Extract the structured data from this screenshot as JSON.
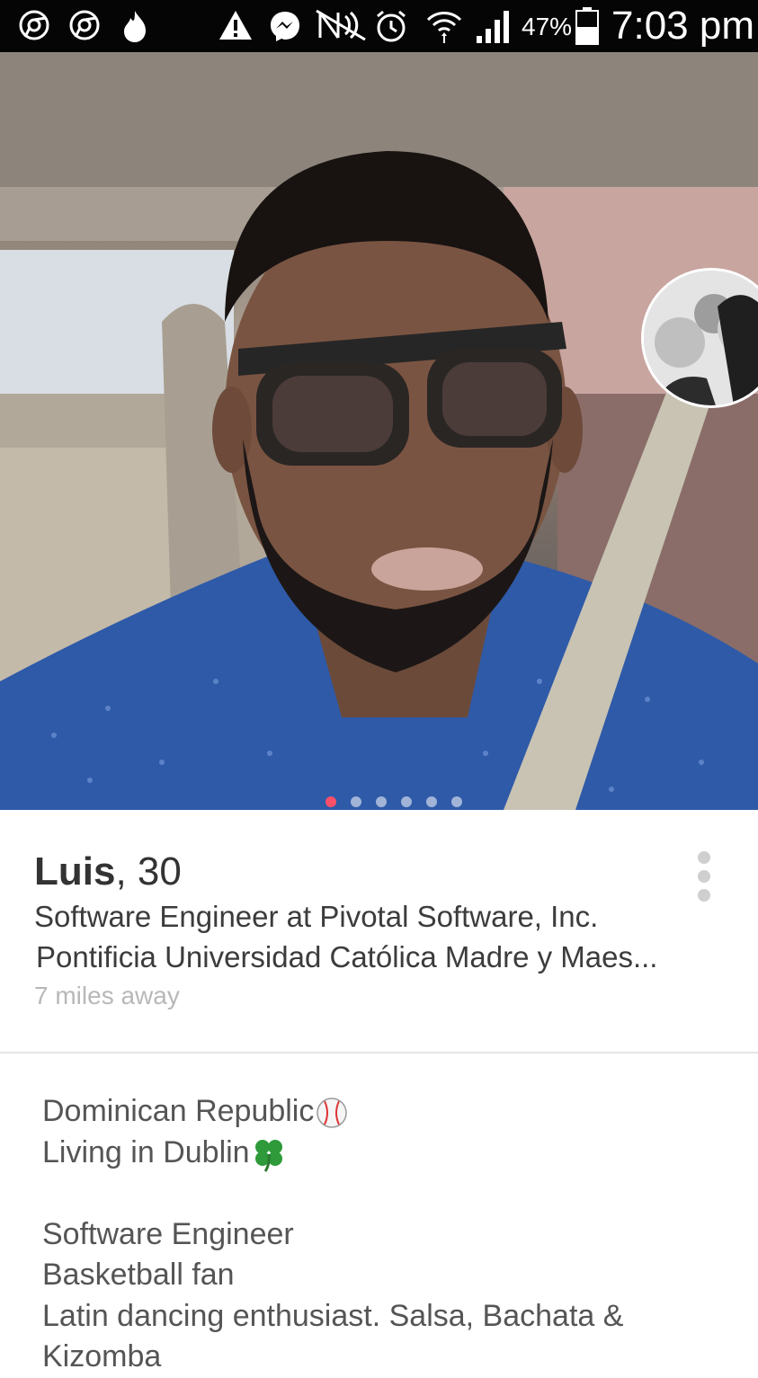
{
  "status_bar": {
    "battery_percent": "47%",
    "time": "7:03 pm",
    "icons": [
      "chrome-icon",
      "chrome-icon",
      "tinder-flame-icon",
      "warning-icon",
      "messenger-icon",
      "nfc-off-icon",
      "alarm-icon",
      "wifi-icon",
      "signal-icon",
      "battery-icon"
    ]
  },
  "photo": {
    "page_count": 6,
    "active_page": 1,
    "active_color": "#fd5068"
  },
  "profile": {
    "name": "Luis",
    "age_text": ", 30",
    "job": "Software Engineer at Pivotal Software, Inc.",
    "school": "Pontificia Universidad Católica Madre y Maes...",
    "distance": "7 miles away"
  },
  "bio": {
    "lines": [
      "Dominican Republic",
      "Living in Dublin",
      "",
      "Software Engineer",
      "Basketball fan",
      "Latin dancing enthusiast. Salsa, Bachata &",
      "Kizomba"
    ],
    "emojis": [
      "baseball-icon",
      "four-leaf-clover-icon"
    ]
  }
}
